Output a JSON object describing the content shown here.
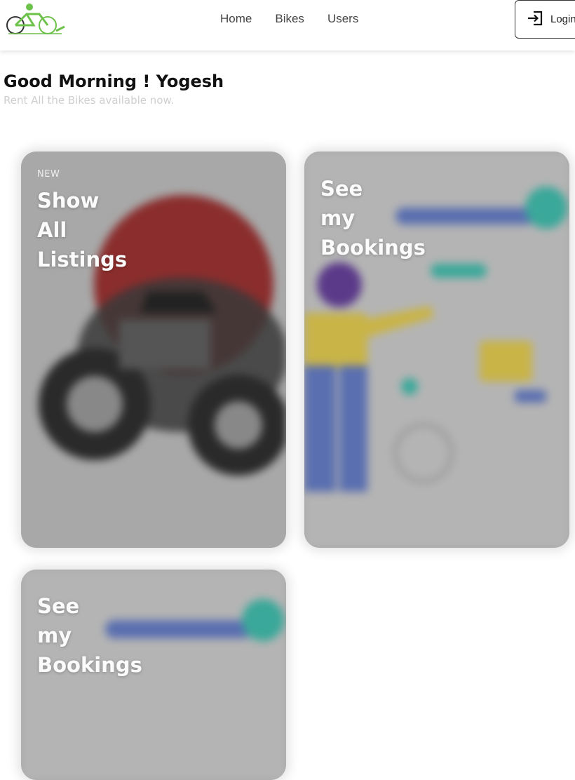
{
  "nav": {
    "links": [
      "Home",
      "Bikes",
      "Users"
    ],
    "login_label": "Login",
    "login_icon": "login-arrow-icon",
    "logo_icon": "bicycle-logo-icon"
  },
  "header": {
    "greeting": "Good Morning ! Yogesh",
    "subtitle": "Rent All the Bikes available now."
  },
  "cards": [
    {
      "eyebrow": "NEW",
      "title_lines": [
        "Show",
        "All",
        "Listings"
      ],
      "art": "motorcycle-illustration"
    },
    {
      "eyebrow": "",
      "title_lines": [
        "See",
        "my",
        "Bookings"
      ],
      "art": "bookings-illustration"
    },
    {
      "eyebrow": "",
      "title_lines": [
        "See",
        "my",
        "Bookings"
      ],
      "art": "bookings-illustration"
    }
  ],
  "colors": {
    "accent_green": "#6cc24a",
    "card_grey": "#a9a9a9",
    "motorcycle_sun": "#8b2d2d",
    "person_shirt": "#c9b448",
    "person_hair": "#5b3a8a",
    "bar_blue": "#5a6fb0",
    "bar_teal": "#3aa89a"
  }
}
